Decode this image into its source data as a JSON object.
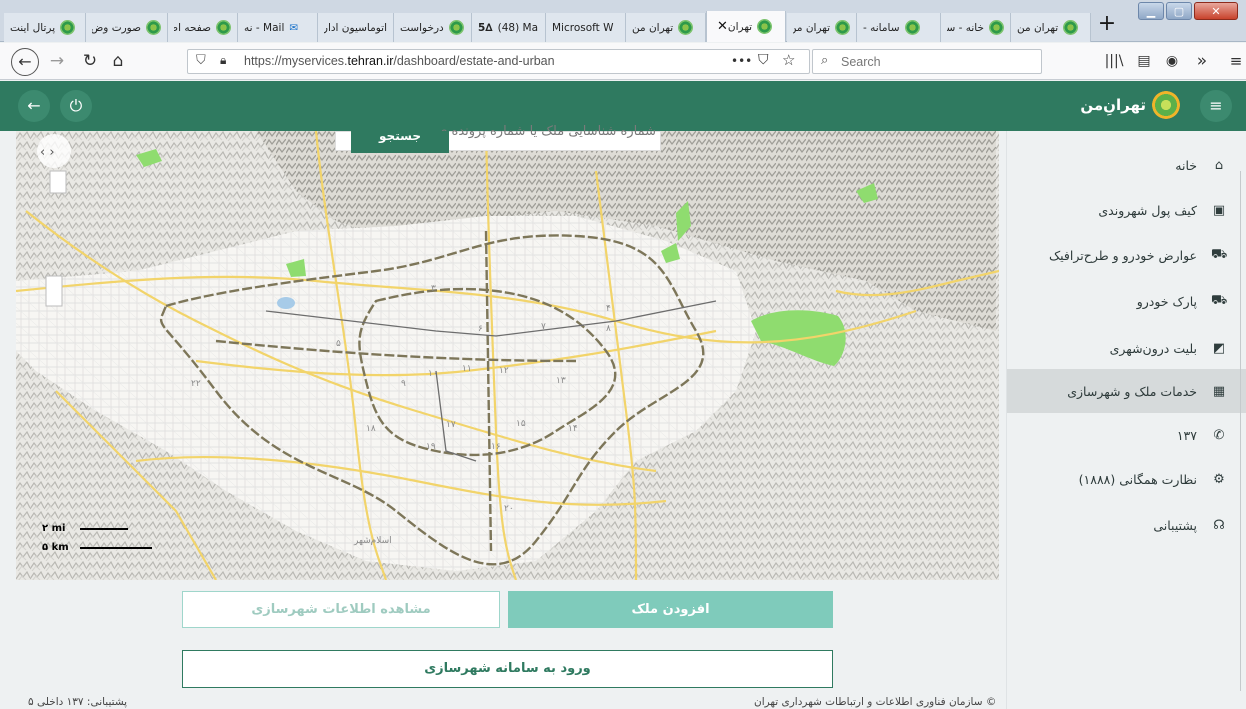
{
  "browser": {
    "tabs": [
      {
        "label": "پرتال اینت"
      },
      {
        "label": "صورت وض"
      },
      {
        "label": "صفحه اص"
      },
      {
        "label": "Mail - نه"
      },
      {
        "label": "اتوماسیون ادار"
      },
      {
        "label": "درخواست"
      },
      {
        "label": "(48) Ma"
      },
      {
        "label": "Microsoft W"
      },
      {
        "label": "تهران من"
      },
      {
        "label": "تهران"
      },
      {
        "label": "تهران من"
      },
      {
        "label": "سامانه -"
      },
      {
        "label": "خانه - سـ"
      },
      {
        "label": "تهران من"
      }
    ],
    "new_tab": "+",
    "url_prefix": "https://myservices.",
    "url_host": "tehran.ir",
    "url_path": "/dashboard/estate-and-urban",
    "search_placeholder": "Search",
    "more_dots": "•••"
  },
  "app": {
    "logo_text": "تهرانِ‌من",
    "search_placeholder": "شماره شناسایی ملک یا شماره پرونده ی",
    "search_button": "جستجو",
    "sidebar": [
      {
        "label": "خانه",
        "icon": "home-icon"
      },
      {
        "label": "کیف پول شهروندی",
        "icon": "wallet-icon"
      },
      {
        "label": "عوارض خودرو و طرح‌ترافیک",
        "icon": "car-icon"
      },
      {
        "label": "پارک خودرو",
        "icon": "parking-icon"
      },
      {
        "label": "بلیت درون‌شهری",
        "icon": "ticket-icon"
      },
      {
        "label": "خدمات ملک و شهرسازی",
        "icon": "building-icon"
      },
      {
        "label": "۱۳۷",
        "icon": "phone-icon"
      },
      {
        "label": "نظارت همگانی (۱۸۸۸)",
        "icon": "gear-icon"
      },
      {
        "label": "پشتیبانی",
        "icon": "headset-icon"
      }
    ],
    "active_item": "خدمات ملک و شهرسازی",
    "scale": {
      "mi": "۲ mi",
      "km": "۵ km"
    },
    "buttons": {
      "add_property": "افزودن ملک",
      "view_urban_info": "مشاهده اطلاعات شهرسازی",
      "login_urban_system": "ورود به سامانه شهرسازی"
    },
    "footer": {
      "support": "پشتیبانی: ۱۳۷ داخلی ۵",
      "copyright": "© سازمان فناوری اطلاعات و ارتباطات شهرداری تهران"
    },
    "map_labels": [
      "۳",
      "۴",
      "۵",
      "۶",
      "۷",
      "۸",
      "۹",
      "۱۰",
      "۱۱",
      "۱۲",
      "۱۳",
      "۱۴",
      "۱۵",
      "۱۶",
      "۱۷",
      "۱۸",
      "۱۹",
      "۲۰",
      "۲۲",
      "اسلام‌شهر"
    ]
  }
}
